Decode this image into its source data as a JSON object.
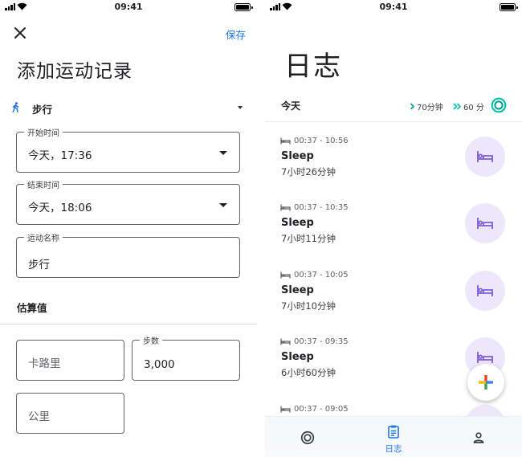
{
  "status_bar": {
    "time": "09:41"
  },
  "add_activity": {
    "save_label": "保存",
    "title": "添加运动记录",
    "activity_type": "步行",
    "start_time": {
      "label": "开始时间",
      "value": "今天，17:36"
    },
    "end_time": {
      "label": "结束时间",
      "value": "今天，18:06"
    },
    "activity_name": {
      "label": "运动名称",
      "value": "步行"
    },
    "estimates_title": "估算值",
    "calories": {
      "placeholder": "卡路里"
    },
    "steps": {
      "label": "步数",
      "value": "3,000"
    },
    "distance": {
      "placeholder": "公里"
    }
  },
  "journal": {
    "title": "日志",
    "today_label": "今天",
    "move_minutes": "70分钟",
    "heart_points": "60 分",
    "entries": [
      {
        "time_range": "00:37 - 10:56",
        "name": "Sleep",
        "duration": "7小时26分钟"
      },
      {
        "time_range": "00:37 - 10:35",
        "name": "Sleep",
        "duration": "7小时11分钟"
      },
      {
        "time_range": "00:37 - 10:05",
        "name": "Sleep",
        "duration": "7小时10分钟"
      },
      {
        "time_range": "00:37 - 09:35",
        "name": "Sleep",
        "duration": "6小时60分钟"
      },
      {
        "time_range": "00:37 - 09:05",
        "name": "",
        "duration": ""
      }
    ],
    "nav": {
      "journal_label": "日志"
    }
  },
  "icons": {
    "close": "close-icon",
    "walk": "walking-icon",
    "sleep": "bed-icon",
    "add": "plus-icon",
    "home": "rings-icon",
    "journal": "clipboard-icon",
    "profile": "person-icon"
  },
  "colors": {
    "accent": "#1a73e8",
    "move_green": "#00a087",
    "heart_teal": "#00bfa5",
    "sleep_purple": "#7c5bd9",
    "sleep_badge_bg": "#ede7fb"
  }
}
